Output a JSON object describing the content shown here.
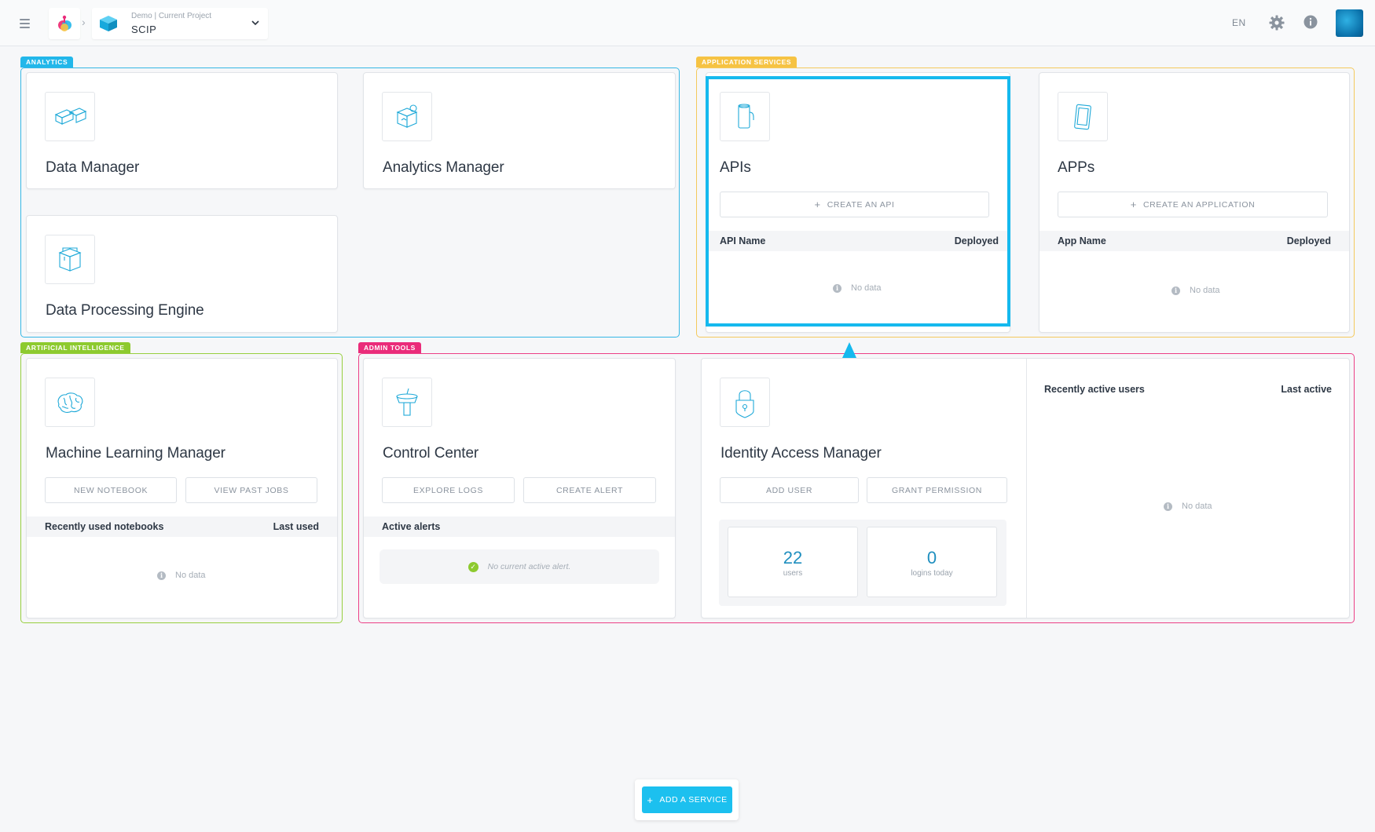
{
  "header": {
    "project_caption": "Demo | Current Project",
    "project_name": "SCIP",
    "language": "EN"
  },
  "sections": {
    "analytics": "ANALYTICS",
    "application_services": "APPLICATION SERVICES",
    "artificial_intelligence": "ARTIFICIAL INTELLIGENCE",
    "admin_tools": "ADMIN TOOLS"
  },
  "cards": {
    "data_manager": {
      "title": "Data Manager"
    },
    "analytics_manager": {
      "title": "Analytics Manager"
    },
    "data_processing_engine": {
      "title": "Data Processing Engine"
    },
    "apis": {
      "title": "APIs",
      "create_label": "CREATE AN API",
      "col_name": "API Name",
      "col_deployed": "Deployed",
      "empty": "No data"
    },
    "apps": {
      "title": "APPs",
      "create_label": "CREATE AN APPLICATION",
      "col_name": "App Name",
      "col_deployed": "Deployed",
      "empty": "No data"
    },
    "ml_manager": {
      "title": "Machine Learning Manager",
      "new_notebook": "NEW NOTEBOOK",
      "view_past_jobs": "VIEW PAST JOBS",
      "col_name": "Recently used notebooks",
      "col_last": "Last used",
      "empty": "No data"
    },
    "control_center": {
      "title": "Control Center",
      "explore_logs": "EXPLORE LOGS",
      "create_alert": "CREATE ALERT",
      "col_name": "Active alerts",
      "empty": "No current active alert."
    },
    "identity_access_manager": {
      "title": "Identity Access Manager",
      "add_user": "ADD USER",
      "grant_permission": "GRANT PERMISSION",
      "users_count": "22",
      "users_label": "users",
      "logins_count": "0",
      "logins_label": "logins today"
    },
    "recent_users": {
      "col_name": "Recently active users",
      "col_last": "Last active",
      "empty": "No data"
    }
  },
  "footer": {
    "add_service": "ADD A SERVICE"
  },
  "colors": {
    "analytics": "#22b7ea",
    "application_services": "#f6c343",
    "artificial_intelligence": "#8dca2f",
    "admin_tools": "#ea2c7a",
    "highlight": "#15b9ee"
  }
}
